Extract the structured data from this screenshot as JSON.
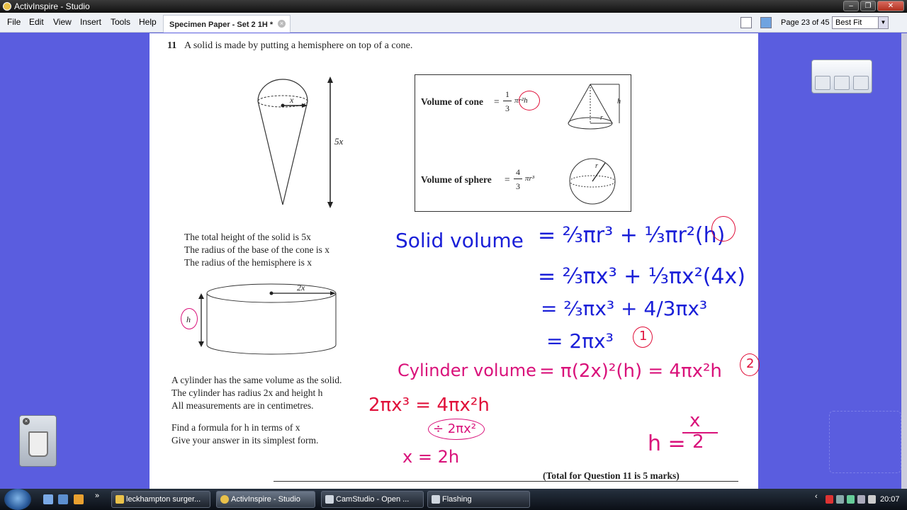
{
  "window": {
    "title": "ActivInspire - Studio"
  },
  "menu": [
    "File",
    "Edit",
    "View",
    "Insert",
    "Tools",
    "Help"
  ],
  "doc_tab": "Specimen Paper - Set 2 1H *",
  "page_label": "Page 23 of 45",
  "zoom": "Best Fit",
  "question": {
    "number": "11",
    "heading": "A solid is made by putting a hemisphere on top of a cone.",
    "formula_cone_label": "Volume of cone",
    "formula_cone_tail": "πr²h",
    "formula_sphere_label": "Volume of sphere",
    "formula_sphere_tail": "πr³",
    "frac_one": "1",
    "frac_three": "3",
    "frac_four": "4",
    "eq": "=",
    "height_label": "5x",
    "radius_label": "x",
    "cyl_radius_label": "2x",
    "cyl_height_label": "h",
    "cone_h_label": "h",
    "cone_r_label": "r",
    "sphere_r_label": "r",
    "info": [
      "The total height of the solid is 5x",
      "The radius of the base of the cone is x",
      "The radius of the hemisphere is x"
    ],
    "cylinder_text": [
      "A cylinder has the same volume as the solid.",
      "The cylinder has radius 2x and height h",
      "All measurements are in centimetres."
    ],
    "task_text": [
      "Find a formula for h in terms of x",
      "Give your answer in its simplest form."
    ],
    "total": "(Total for Question 11 is 5 marks)"
  },
  "handwriting": {
    "solid_volume": "Solid volume",
    "line1": "= ⅔πr³ + ⅓πr²(h)",
    "line2": "= ⅔πx³ + ⅓πx²(4x)",
    "line3": "= ⅔πx³ + 4/3πx³",
    "line4": "= 2πx³",
    "mark1": "1",
    "cylinder_volume": "Cylinder volume",
    "cyl_eq": "= π(2x)²(h) = 4πx²h",
    "mark2": "2",
    "eq1": "2πx³ = 4πx²h",
    "eq2": "÷ 2πx²",
    "eq3": "x = 2h",
    "answer_h": "h =",
    "answer_num": "x",
    "answer_den": "2"
  },
  "taskbar": {
    "buttons": [
      "leckhampton surger...",
      "ActivInspire - Studio",
      "CamStudio - Open ...",
      "Flashing"
    ],
    "clock": "20:07"
  },
  "colors": {
    "page_bg": "#5a5ddf",
    "ink_blue": "#1a1fd8",
    "ink_red": "#e0103a",
    "ink_magenta": "#d9117a"
  }
}
